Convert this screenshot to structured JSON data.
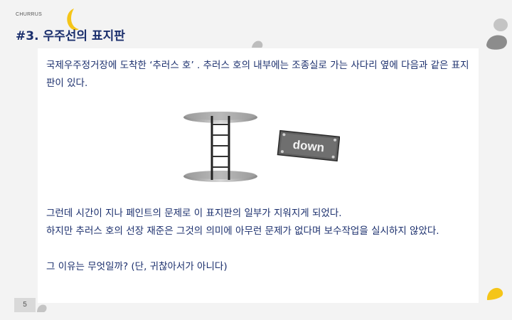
{
  "header": {
    "brand": "CHURRUS",
    "title": "#3. 우주선의 표지판"
  },
  "content": {
    "paragraph1": "국제우주정거장에 도착한 ‘추러스 호’ . 추러스 호의 내부에는 조종실로 가는 사다리 옆에 다음과 같은 표지판이 있다.",
    "sign_text": "down",
    "paragraph2_lines": [
      "그런데 시간이 지나 페인트의 문제로 이 표지판의 일부가 지워지게 되었다.",
      "하지만 추러스 호의 선장 재준은 그것의 의미에 아무런 문제가 없다며 보수작업을 실시하지 않았다.",
      "",
      "그 이유는 무엇일까? (단, 귀찮아서가 아니다)"
    ]
  },
  "footer": {
    "page_number": "5"
  },
  "colors": {
    "title": "#1b2f6d",
    "text": "#1b2f6d",
    "accent_yellow": "#f5c518",
    "deco_gray": "#b0b0b0",
    "sign_gray": "#6b6b6b"
  },
  "icons": [
    "moon-icon",
    "ladder-illustration",
    "down-sign",
    "gray-blob-decoration",
    "yellow-blob-decoration"
  ]
}
